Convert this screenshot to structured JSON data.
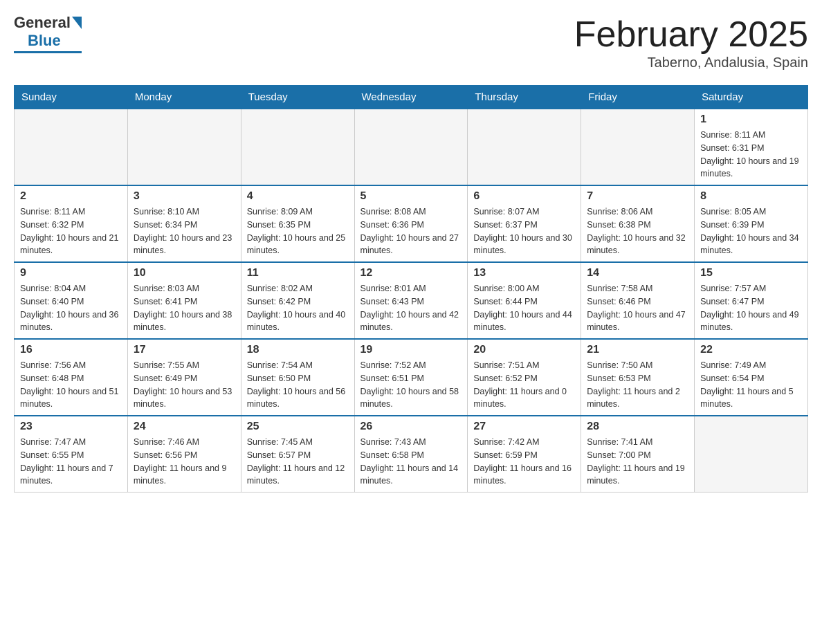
{
  "logo": {
    "general": "General",
    "blue": "Blue"
  },
  "title": {
    "month_year": "February 2025",
    "location": "Taberno, Andalusia, Spain"
  },
  "headers": [
    "Sunday",
    "Monday",
    "Tuesday",
    "Wednesday",
    "Thursday",
    "Friday",
    "Saturday"
  ],
  "weeks": [
    [
      {
        "day": "",
        "info": ""
      },
      {
        "day": "",
        "info": ""
      },
      {
        "day": "",
        "info": ""
      },
      {
        "day": "",
        "info": ""
      },
      {
        "day": "",
        "info": ""
      },
      {
        "day": "",
        "info": ""
      },
      {
        "day": "1",
        "info": "Sunrise: 8:11 AM\nSunset: 6:31 PM\nDaylight: 10 hours and 19 minutes."
      }
    ],
    [
      {
        "day": "2",
        "info": "Sunrise: 8:11 AM\nSunset: 6:32 PM\nDaylight: 10 hours and 21 minutes."
      },
      {
        "day": "3",
        "info": "Sunrise: 8:10 AM\nSunset: 6:34 PM\nDaylight: 10 hours and 23 minutes."
      },
      {
        "day": "4",
        "info": "Sunrise: 8:09 AM\nSunset: 6:35 PM\nDaylight: 10 hours and 25 minutes."
      },
      {
        "day": "5",
        "info": "Sunrise: 8:08 AM\nSunset: 6:36 PM\nDaylight: 10 hours and 27 minutes."
      },
      {
        "day": "6",
        "info": "Sunrise: 8:07 AM\nSunset: 6:37 PM\nDaylight: 10 hours and 30 minutes."
      },
      {
        "day": "7",
        "info": "Sunrise: 8:06 AM\nSunset: 6:38 PM\nDaylight: 10 hours and 32 minutes."
      },
      {
        "day": "8",
        "info": "Sunrise: 8:05 AM\nSunset: 6:39 PM\nDaylight: 10 hours and 34 minutes."
      }
    ],
    [
      {
        "day": "9",
        "info": "Sunrise: 8:04 AM\nSunset: 6:40 PM\nDaylight: 10 hours and 36 minutes."
      },
      {
        "day": "10",
        "info": "Sunrise: 8:03 AM\nSunset: 6:41 PM\nDaylight: 10 hours and 38 minutes."
      },
      {
        "day": "11",
        "info": "Sunrise: 8:02 AM\nSunset: 6:42 PM\nDaylight: 10 hours and 40 minutes."
      },
      {
        "day": "12",
        "info": "Sunrise: 8:01 AM\nSunset: 6:43 PM\nDaylight: 10 hours and 42 minutes."
      },
      {
        "day": "13",
        "info": "Sunrise: 8:00 AM\nSunset: 6:44 PM\nDaylight: 10 hours and 44 minutes."
      },
      {
        "day": "14",
        "info": "Sunrise: 7:58 AM\nSunset: 6:46 PM\nDaylight: 10 hours and 47 minutes."
      },
      {
        "day": "15",
        "info": "Sunrise: 7:57 AM\nSunset: 6:47 PM\nDaylight: 10 hours and 49 minutes."
      }
    ],
    [
      {
        "day": "16",
        "info": "Sunrise: 7:56 AM\nSunset: 6:48 PM\nDaylight: 10 hours and 51 minutes."
      },
      {
        "day": "17",
        "info": "Sunrise: 7:55 AM\nSunset: 6:49 PM\nDaylight: 10 hours and 53 minutes."
      },
      {
        "day": "18",
        "info": "Sunrise: 7:54 AM\nSunset: 6:50 PM\nDaylight: 10 hours and 56 minutes."
      },
      {
        "day": "19",
        "info": "Sunrise: 7:52 AM\nSunset: 6:51 PM\nDaylight: 10 hours and 58 minutes."
      },
      {
        "day": "20",
        "info": "Sunrise: 7:51 AM\nSunset: 6:52 PM\nDaylight: 11 hours and 0 minutes."
      },
      {
        "day": "21",
        "info": "Sunrise: 7:50 AM\nSunset: 6:53 PM\nDaylight: 11 hours and 2 minutes."
      },
      {
        "day": "22",
        "info": "Sunrise: 7:49 AM\nSunset: 6:54 PM\nDaylight: 11 hours and 5 minutes."
      }
    ],
    [
      {
        "day": "23",
        "info": "Sunrise: 7:47 AM\nSunset: 6:55 PM\nDaylight: 11 hours and 7 minutes."
      },
      {
        "day": "24",
        "info": "Sunrise: 7:46 AM\nSunset: 6:56 PM\nDaylight: 11 hours and 9 minutes."
      },
      {
        "day": "25",
        "info": "Sunrise: 7:45 AM\nSunset: 6:57 PM\nDaylight: 11 hours and 12 minutes."
      },
      {
        "day": "26",
        "info": "Sunrise: 7:43 AM\nSunset: 6:58 PM\nDaylight: 11 hours and 14 minutes."
      },
      {
        "day": "27",
        "info": "Sunrise: 7:42 AM\nSunset: 6:59 PM\nDaylight: 11 hours and 16 minutes."
      },
      {
        "day": "28",
        "info": "Sunrise: 7:41 AM\nSunset: 7:00 PM\nDaylight: 11 hours and 19 minutes."
      },
      {
        "day": "",
        "info": ""
      }
    ]
  ]
}
